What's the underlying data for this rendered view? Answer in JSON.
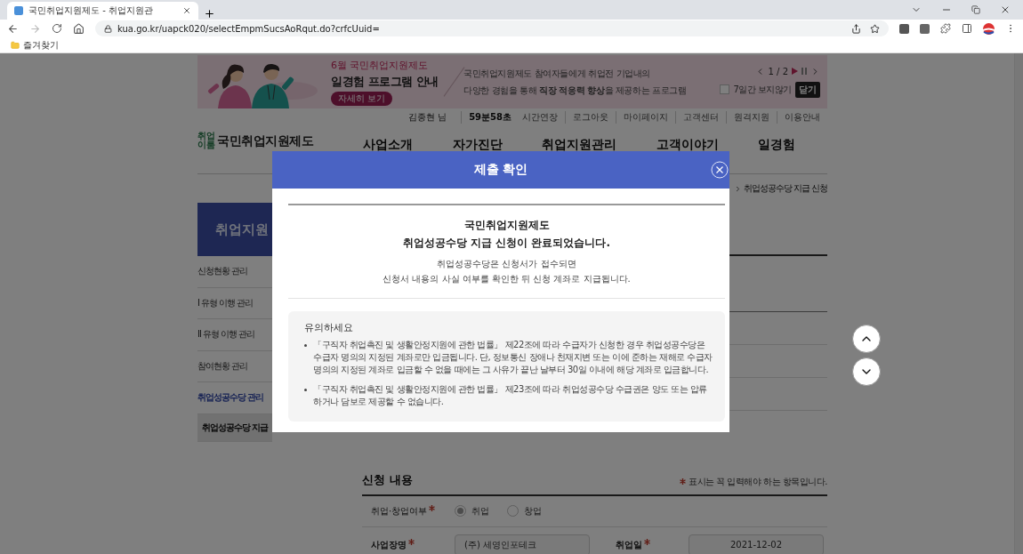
{
  "browser": {
    "tab_title": "국민취업지원제도 - 취업지원관",
    "url": "kua.go.kr/uapck020/selectEmpmSucsAoRqut.do?crfcUuid=",
    "bookmarks": [
      "즐겨찾기"
    ]
  },
  "banner": {
    "eyebrow": "6월 국민취업지원제도",
    "title": "일경험 프로그램 안내",
    "detail_button": "자세히 보기",
    "description": [
      "국민취업지원제도 참여자들에게 취업전 기업내의",
      "다양한 경험을 통해 **직장 적응력 향상**을 제공하는 프로그램"
    ],
    "pager": "1 / 2",
    "hide_option": {
      "label": "7일간 보지않기",
      "checked": false
    },
    "close_button": "닫기"
  },
  "utility_links": [
    {
      "kind": "user",
      "text": "김종현 님"
    },
    {
      "kind": "timer",
      "text": "59분58초"
    },
    {
      "kind": "link",
      "text": "시간연장"
    },
    {
      "kind": "link",
      "text": "로그아웃"
    },
    {
      "kind": "link",
      "text": "마이페이지"
    },
    {
      "kind": "link",
      "text": "고객센터"
    },
    {
      "kind": "link",
      "text": "원격지원"
    },
    {
      "kind": "link",
      "text": "이용안내"
    }
  ],
  "logo": {
    "mark": [
      "취업",
      "이룸"
    ],
    "title": "국민취업지원제도"
  },
  "nav": [
    "사업소개",
    "자가진단",
    "취업지원관리",
    "고객이야기",
    "일경험"
  ],
  "breadcrumb": "취업성공수당 지급 신청",
  "sidebar": {
    "title": "취업지원",
    "items": [
      {
        "label": "신청현황 관리",
        "selected": false
      },
      {
        "label": "I 유형 이행 관리",
        "selected": false
      },
      {
        "label": "II 유형 이행 관리",
        "selected": false
      },
      {
        "label": "참여현황 관리",
        "selected": false
      },
      {
        "label": "취업성공수당 관리",
        "selected": true,
        "children": [
          {
            "label": "취업성공수당 지급",
            "selected": true
          }
        ]
      }
    ]
  },
  "form": {
    "title": "신청 내용",
    "required_note": "표시는 꼭 입력해야 하는 항목입니다.",
    "rows": [
      {
        "kind": "radio",
        "label": "취업·창업여부",
        "required": true,
        "options": [
          {
            "label": "취업",
            "selected": true
          },
          {
            "label": "창업",
            "selected": false
          }
        ]
      },
      {
        "kind": "fields",
        "fields": [
          {
            "label": "사업장명",
            "required": true,
            "value": "(주) 세영인포테크"
          },
          {
            "label": "취업일",
            "required": true,
            "value": "2021-12-02"
          }
        ]
      }
    ]
  },
  "modal": {
    "title": "제출 확인",
    "heading": "국민취업지원제도",
    "result": "**취업성공수당 지급 신청이 완료**되었습니다.",
    "message": [
      "취업성공수당은 신청서가 접수되면",
      "신청서 내용의 사실 여부를 확인한 뒤 신청 계좌로 지급됩니다."
    ],
    "notice": {
      "title": "유의하세요",
      "items": [
        "「구직자 취업촉진 및 생활안정지원에 관한 법률」 제22조에 따라 수급자가 신청한 경우 취업성공수당은 수급자 명의의 지정된 계좌로만 입금됩니다. 단, 정보통신 장애나 천재지변 또는 이에 준하는 재해로 수급자 명의의 지정된 계좌로 입금할 수 없을 때에는 그 사유가 끝난 날부터 30일 이내에 해당 계좌로 입금합니다.",
        "「구직자 취업촉진 및 생활안정지원에 관한 법률」 제23조에 따라 취업성공수당 수급권은 양도 또는 압류하거나 담보로 제공할 수 없습니다."
      ]
    }
  }
}
